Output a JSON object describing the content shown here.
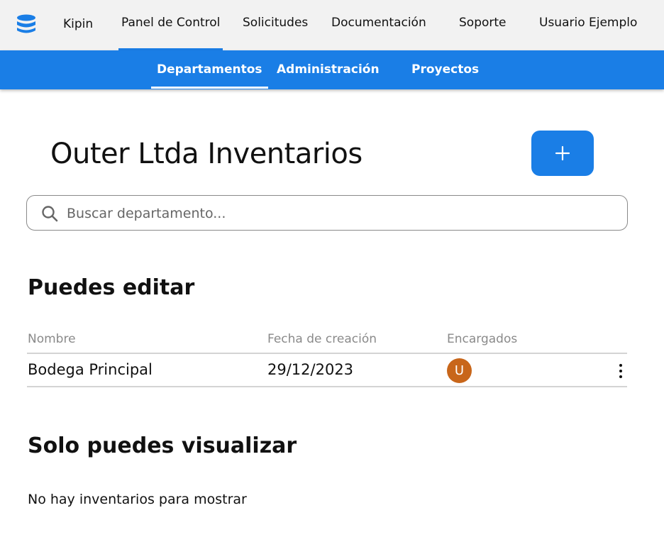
{
  "colors": {
    "accent": "#1a7ee6",
    "topbar_bg": "#f2f2f2",
    "avatar_bg": "#c8661a"
  },
  "topbar": {
    "logo_icon": "database-icon",
    "brand": "Kipin",
    "nav": [
      {
        "label": "Panel de Control",
        "active": true
      },
      {
        "label": "Solicitudes",
        "active": false
      },
      {
        "label": "Documentación",
        "active": false
      },
      {
        "label": "Soporte",
        "active": false
      }
    ],
    "user": "Usuario Ejemplo"
  },
  "subnav": {
    "tabs": [
      {
        "label": "Departamentos",
        "active": true
      },
      {
        "label": "Administración",
        "active": false
      },
      {
        "label": "Proyectos",
        "active": false
      }
    ]
  },
  "main": {
    "title": "Outer Ltda Inventarios",
    "add_button_icon": "plus-icon",
    "search": {
      "placeholder": "Buscar departamento...",
      "value": ""
    }
  },
  "editable": {
    "heading": "Puedes editar",
    "columns": [
      "Nombre",
      "Fecha de creación",
      "Encargados"
    ],
    "rows": [
      {
        "name": "Bodega Principal",
        "created": "29/12/2023",
        "managers": [
          "U"
        ]
      }
    ]
  },
  "view_only": {
    "heading": "Solo puedes visualizar",
    "empty_message": "No hay inventarios para mostrar"
  }
}
